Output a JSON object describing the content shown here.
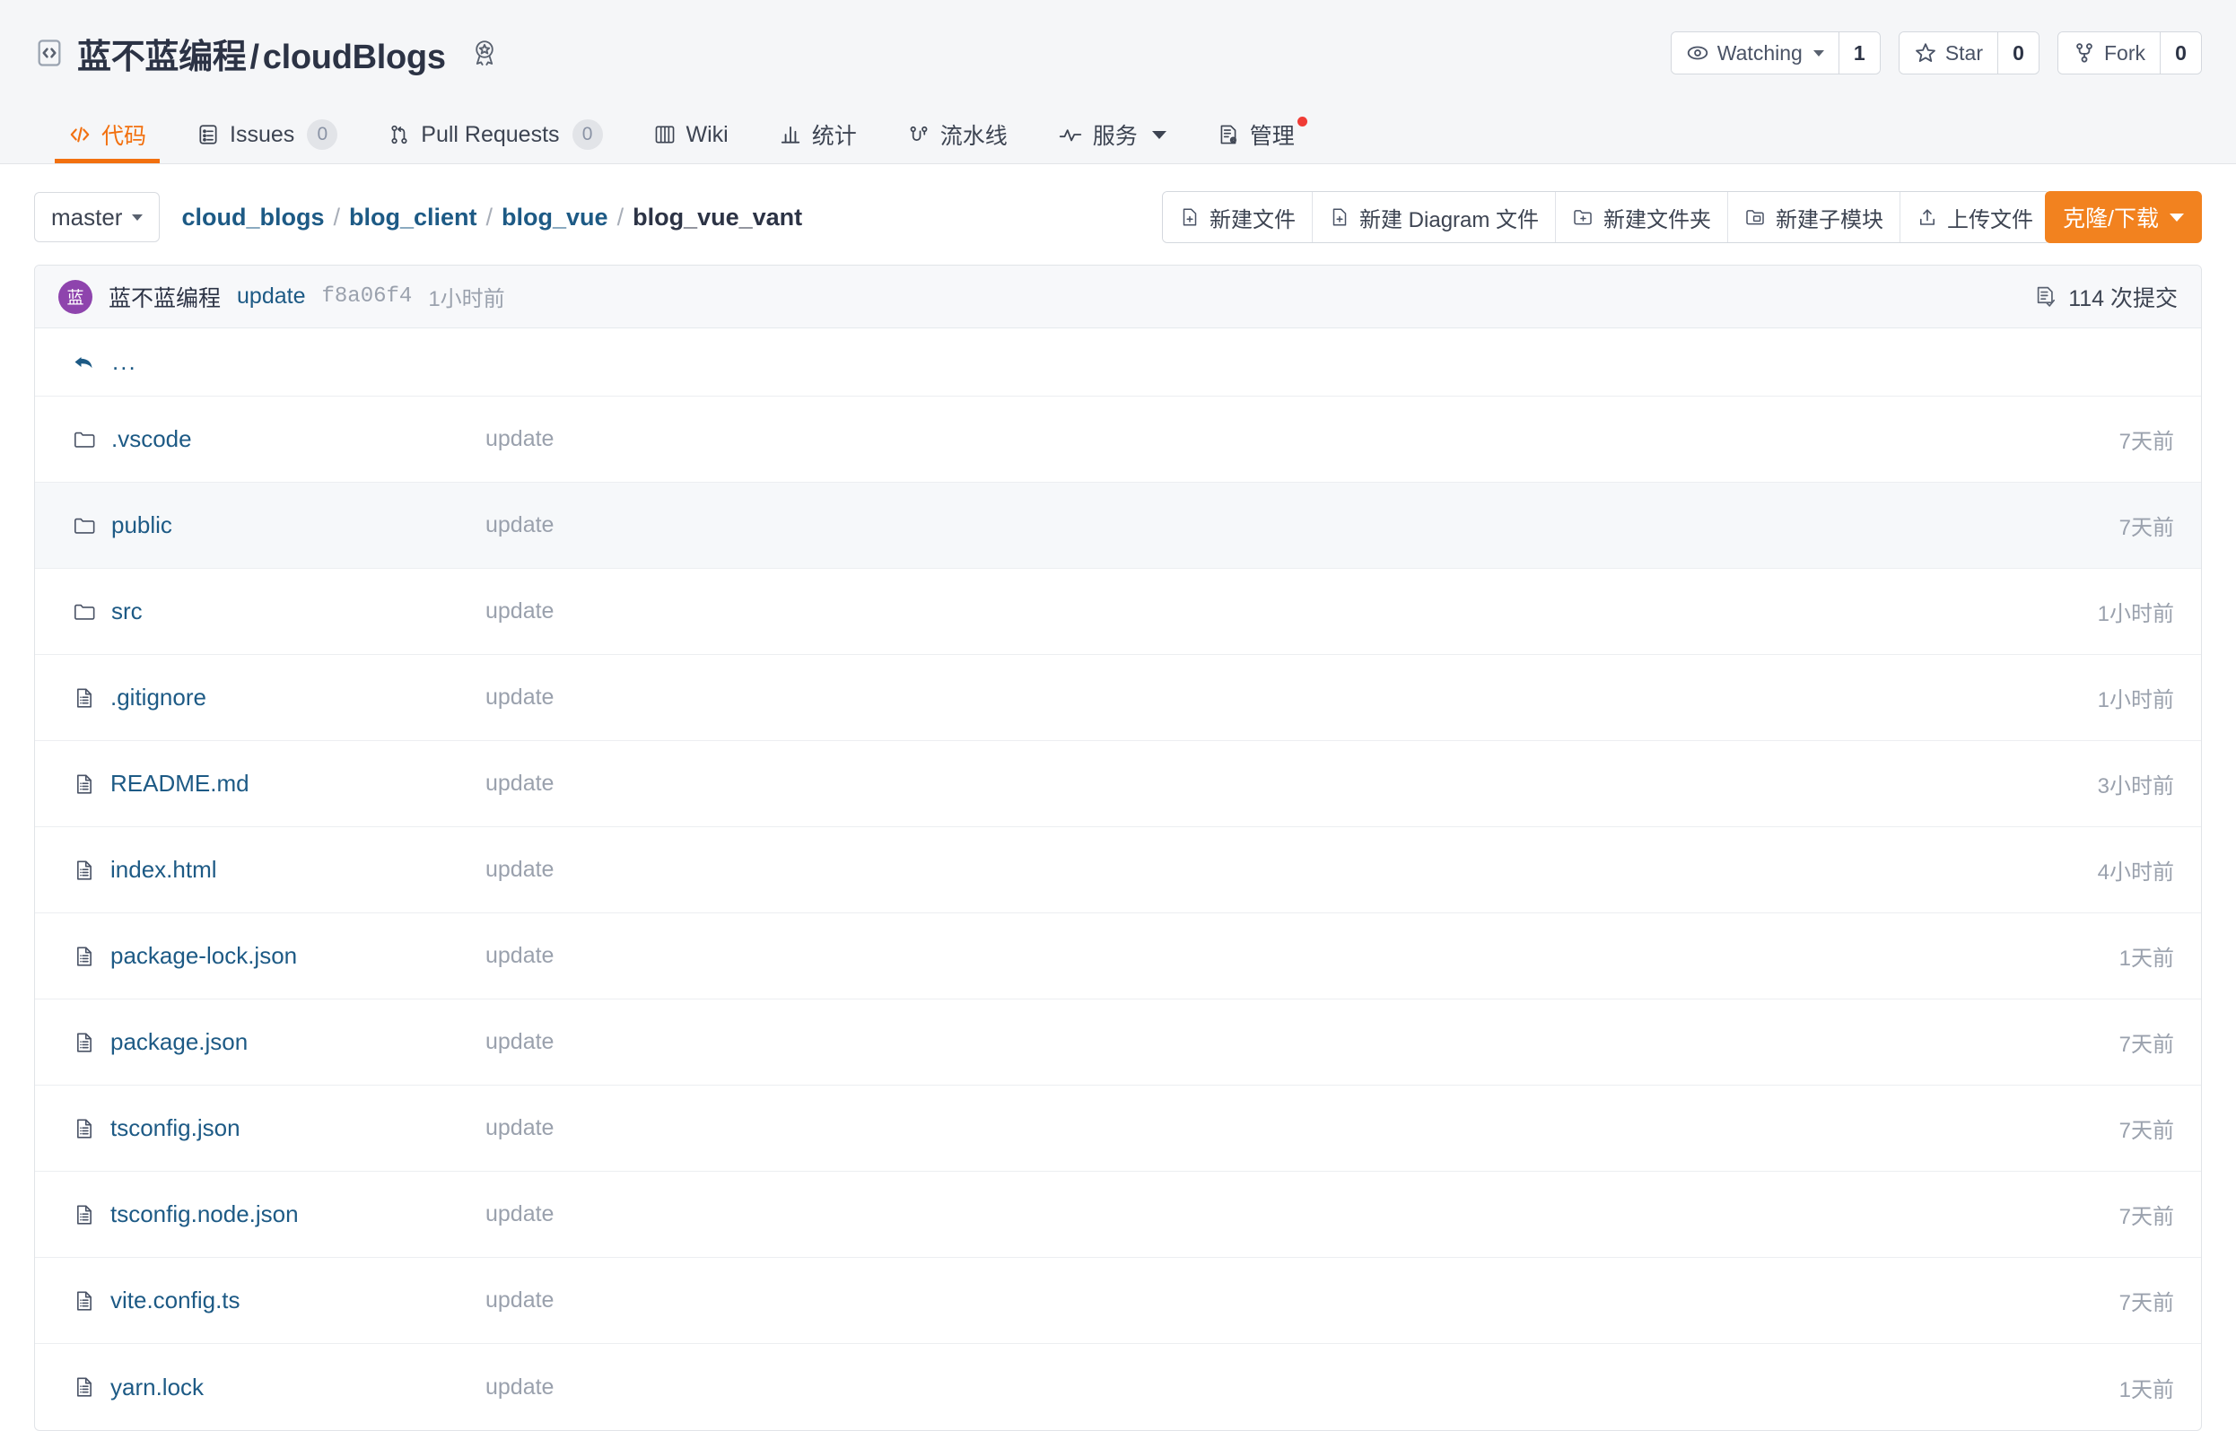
{
  "header": {
    "code_icon": "code-brackets-icon",
    "owner": "蓝不蓝编程",
    "separator": "/",
    "repo": "cloudBlogs",
    "badge_icon": "award-ribbon-icon",
    "actions": {
      "watching_label": "Watching",
      "watching_count": "1",
      "star_label": "Star",
      "star_count": "0",
      "fork_label": "Fork",
      "fork_count": "0"
    }
  },
  "tabs": [
    {
      "label": "代码",
      "icon": "code-icon",
      "badge": null,
      "active": true,
      "caret": false,
      "dot": false
    },
    {
      "label": "Issues",
      "icon": "issue-icon",
      "badge": "0",
      "active": false,
      "caret": false,
      "dot": false
    },
    {
      "label": "Pull Requests",
      "icon": "pull-request-icon",
      "badge": "0",
      "active": false,
      "caret": false,
      "dot": false
    },
    {
      "label": "Wiki",
      "icon": "book-icon",
      "badge": null,
      "active": false,
      "caret": false,
      "dot": false
    },
    {
      "label": "统计",
      "icon": "chart-icon",
      "badge": null,
      "active": false,
      "caret": false,
      "dot": false
    },
    {
      "label": "流水线",
      "icon": "pipeline-icon",
      "badge": null,
      "active": false,
      "caret": false,
      "dot": false
    },
    {
      "label": "服务",
      "icon": "activity-icon",
      "badge": null,
      "active": false,
      "caret": true,
      "dot": false
    },
    {
      "label": "管理",
      "icon": "settings-doc-icon",
      "badge": null,
      "active": false,
      "caret": false,
      "dot": true
    }
  ],
  "toolbar": {
    "branch": "master",
    "breadcrumb": [
      "cloud_blogs",
      "blog_client",
      "blog_vue",
      "blog_vue_vant"
    ],
    "breadcrumb_separator": "/",
    "actions": [
      {
        "label": "新建文件",
        "icon": "new-file-icon"
      },
      {
        "label": "新建 Diagram 文件",
        "icon": "new-file-icon"
      },
      {
        "label": "新建文件夹",
        "icon": "new-folder-icon"
      },
      {
        "label": "新建子模块",
        "icon": "new-submodule-icon"
      },
      {
        "label": "上传文件",
        "icon": "upload-icon"
      }
    ],
    "clone_label": "克隆/下载"
  },
  "commit_bar": {
    "avatar_text": "蓝",
    "author": "蓝不蓝编程",
    "message": "update",
    "hash": "f8a06f4",
    "time": "1小时前",
    "commit_count_label": "114 次提交",
    "commit_count_icon": "commit-history-icon"
  },
  "file_list": {
    "parent_label": "...",
    "parent_icon": "back-arrow-icon",
    "rows": [
      {
        "name": ".vscode",
        "type": "folder",
        "icon": "folder-icon",
        "message": "update",
        "time": "7天前"
      },
      {
        "name": "public",
        "type": "folder",
        "icon": "folder-icon",
        "message": "update",
        "time": "7天前"
      },
      {
        "name": "src",
        "type": "folder",
        "icon": "folder-icon",
        "message": "update",
        "time": "1小时前"
      },
      {
        "name": ".gitignore",
        "type": "file",
        "icon": "file-icon",
        "message": "update",
        "time": "1小时前"
      },
      {
        "name": "README.md",
        "type": "file",
        "icon": "file-icon",
        "message": "update",
        "time": "3小时前"
      },
      {
        "name": "index.html",
        "type": "file",
        "icon": "file-icon",
        "message": "update",
        "time": "4小时前"
      },
      {
        "name": "package-lock.json",
        "type": "file",
        "icon": "file-icon",
        "message": "update",
        "time": "1天前"
      },
      {
        "name": "package.json",
        "type": "file",
        "icon": "file-icon",
        "message": "update",
        "time": "7天前"
      },
      {
        "name": "tsconfig.json",
        "type": "file",
        "icon": "file-icon",
        "message": "update",
        "time": "7天前"
      },
      {
        "name": "tsconfig.node.json",
        "type": "file",
        "icon": "file-icon",
        "message": "update",
        "time": "7天前"
      },
      {
        "name": "vite.config.ts",
        "type": "file",
        "icon": "file-icon",
        "message": "update",
        "time": "7天前"
      },
      {
        "name": "yarn.lock",
        "type": "file",
        "icon": "file-icon",
        "message": "update",
        "time": "1天前"
      }
    ]
  },
  "colors": {
    "accent_orange": "#f2700f",
    "clone_orange": "#f2821f",
    "link_blue": "#1d5a85",
    "text_dark": "#2c3345",
    "muted_gray": "#9aa1ad",
    "avatar_purple": "#8e44ad",
    "notification_red": "#f03c36",
    "header_bg": "#f5f6f8",
    "row_alt_bg": "#f6f8fa"
  }
}
